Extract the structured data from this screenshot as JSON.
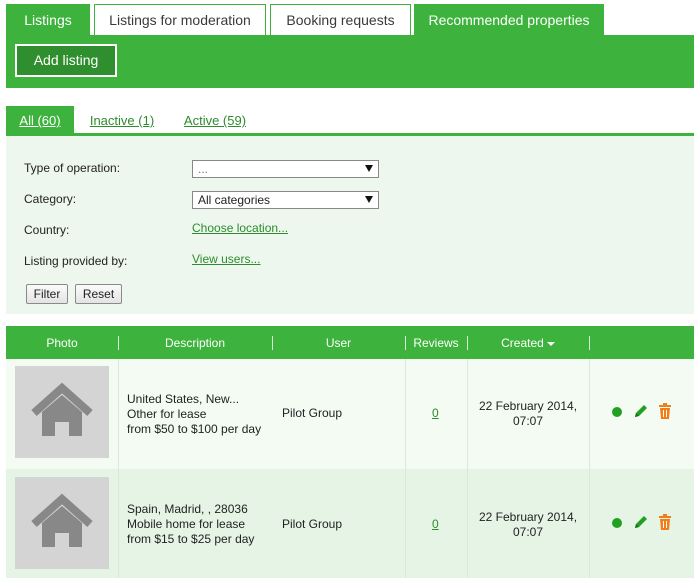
{
  "top_tabs": [
    {
      "label": "Listings",
      "active": true
    },
    {
      "label": "Listings for moderation",
      "active": false
    },
    {
      "label": "Booking requests",
      "active": false
    },
    {
      "label": "Recommended properties",
      "active": true
    }
  ],
  "toolbar": {
    "add_label": "Add listing"
  },
  "sub_tabs": [
    {
      "label": "All (60)",
      "active": true
    },
    {
      "label": "Inactive (1)",
      "active": false
    },
    {
      "label": "Active (59)",
      "active": false
    }
  ],
  "filter": {
    "type_label": "Type of operation:",
    "type_value": "...",
    "category_label": "Category:",
    "category_value": "All categories",
    "country_label": "Country:",
    "country_link": "Choose location...",
    "provider_label": "Listing provided by:",
    "provider_link": "View users...",
    "filter_btn": "Filter",
    "reset_btn": "Reset"
  },
  "table": {
    "headers": {
      "photo": "Photo",
      "description": "Description",
      "user": "User",
      "reviews": "Reviews",
      "created": "Created"
    },
    "rows": [
      {
        "desc_line1": "United States, New...",
        "desc_line2": "Other for lease",
        "desc_line3": "from $50 to $100 per day",
        "user": "Pilot Group",
        "reviews": "0",
        "created_line1": "22 February 2014,",
        "created_line2": "07:07"
      },
      {
        "desc_line1": "Spain, Madrid, , 28036",
        "desc_line2": "Mobile home for lease",
        "desc_line3": "from $15 to $25 per day",
        "user": "Pilot Group",
        "reviews": "0",
        "created_line1": "22 February 2014,",
        "created_line2": "07:07"
      }
    ]
  },
  "colors": {
    "brand_green": "#3db33d",
    "link_green": "#2e8b2e",
    "delete_orange": "#f07f1a",
    "status_green": "#22a022"
  },
  "icons": [
    "house-icon",
    "status-active-icon",
    "edit-pencil-icon",
    "delete-trash-icon",
    "sort-caret-icon",
    "select-arrow-icon"
  ]
}
